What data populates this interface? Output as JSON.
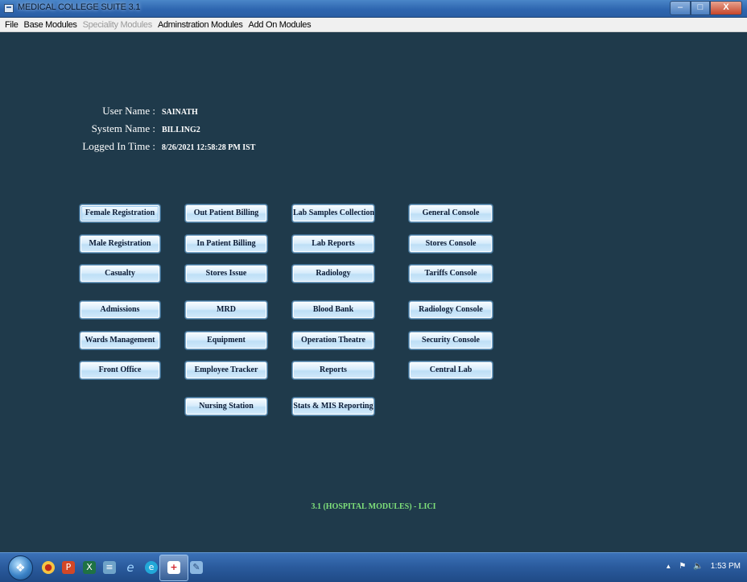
{
  "window": {
    "title": "MEDICAL COLLEGE SUITE 3.1",
    "minimize": "–",
    "maximize": "□",
    "close": "X"
  },
  "menu": [
    {
      "label": "File",
      "enabled": true
    },
    {
      "label": "Base Modules",
      "enabled": true
    },
    {
      "label": "Speciality Modules",
      "enabled": false
    },
    {
      "label": "Adminstration Modules",
      "enabled": true
    },
    {
      "label": "Add On Modules",
      "enabled": true
    }
  ],
  "user_info": {
    "user_name_label": "User Name :",
    "user_name": "SAINATH",
    "system_name_label": "System Name :",
    "system_name": "BILLING2",
    "logged_in_label": "Logged In Time :",
    "logged_in_time": "8/26/2021 12:58:28 PM IST"
  },
  "modules": {
    "col1": [
      "Female Registration",
      "Male Registration",
      "Casualty",
      "Admissions",
      "Wards Management",
      "Front Office"
    ],
    "col2": [
      "Out Patient Billing",
      "In Patient Billing",
      "Stores Issue",
      "MRD",
      "Equipment",
      "Employee Tracker",
      "Nursing Station"
    ],
    "col3": [
      "Lab Samples Collection",
      "Lab Reports",
      "Radiology",
      "Blood Bank",
      "Operation Theatre",
      "Reports",
      "Stats & MIS Reporting"
    ],
    "col4": [
      "General Console",
      "Stores Console",
      "Tariffs Console",
      "Radiology Console",
      "Security Console",
      "Central Lab"
    ]
  },
  "version_text": "3.1 (HOSPITAL MODULES) - LICI",
  "taskbar": {
    "clock": "1:53 PM",
    "tray_arrow": "▲",
    "icons": [
      "windows-start-icon",
      "chrome-icon",
      "powerpoint-icon",
      "excel-icon",
      "notepad-icon",
      "internet-explorer-icon",
      "edge-icon",
      "medical-suite-icon",
      "paint-icon"
    ]
  }
}
